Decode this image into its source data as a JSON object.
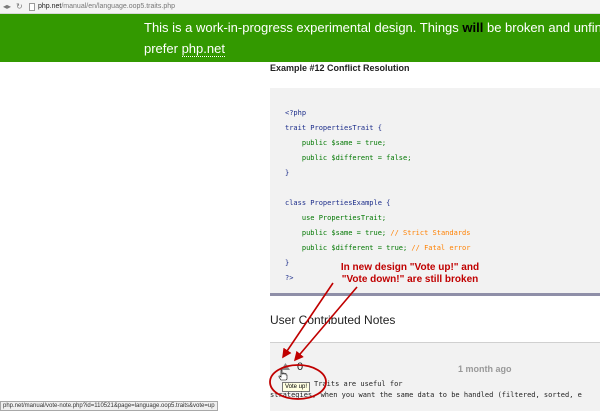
{
  "browser": {
    "back_glyph": "◂▸",
    "reload_glyph": "↻",
    "url_host": "php.net",
    "url_path": "/manual/en/language.oop5.traits.php",
    "status_text": "php.net/manual/vote-note.php?id=110521&page=language.oop5.traits&vote=up"
  },
  "banner": {
    "line1_prefix": "This is a work-in-progress experimental design. Things ",
    "line1_strong": "will",
    "line1_suffix": " be broken and unfinis",
    "line2_prefix": "prefer ",
    "line2_link": "php.net",
    "bg_color": "#339900"
  },
  "example": {
    "title": "Example #12 Conflict Resolution",
    "code": {
      "open_tag": "<?php",
      "trait_decl": "trait PropertiesTrait {",
      "t_same": "    public $same = true;",
      "t_diff": "    public $different = false;",
      "close_brace": "}",
      "class_decl": "class PropertiesExample {",
      "use_stmt": "    use PropertiesTrait;",
      "c_same": "    public $same = true;",
      "c_same_comment": " // Strict Standards",
      "c_diff": "    public $different = true;",
      "c_diff_comment": " // Fatal error",
      "close_tag": "?>"
    }
  },
  "annotation": {
    "line1": "In new design \"Vote up!\" and",
    "line2": "\"Vote down!\" are still broken",
    "color": "#c00000"
  },
  "notes": {
    "title": "User Contributed Notes",
    "vote_count": "0",
    "date": "1 month ago",
    "tooltip": "Vote up!",
    "text_line1": "Traits are useful for",
    "text_line2": "strategies, when you want the same data to be handled (filtered, sorted, e"
  }
}
